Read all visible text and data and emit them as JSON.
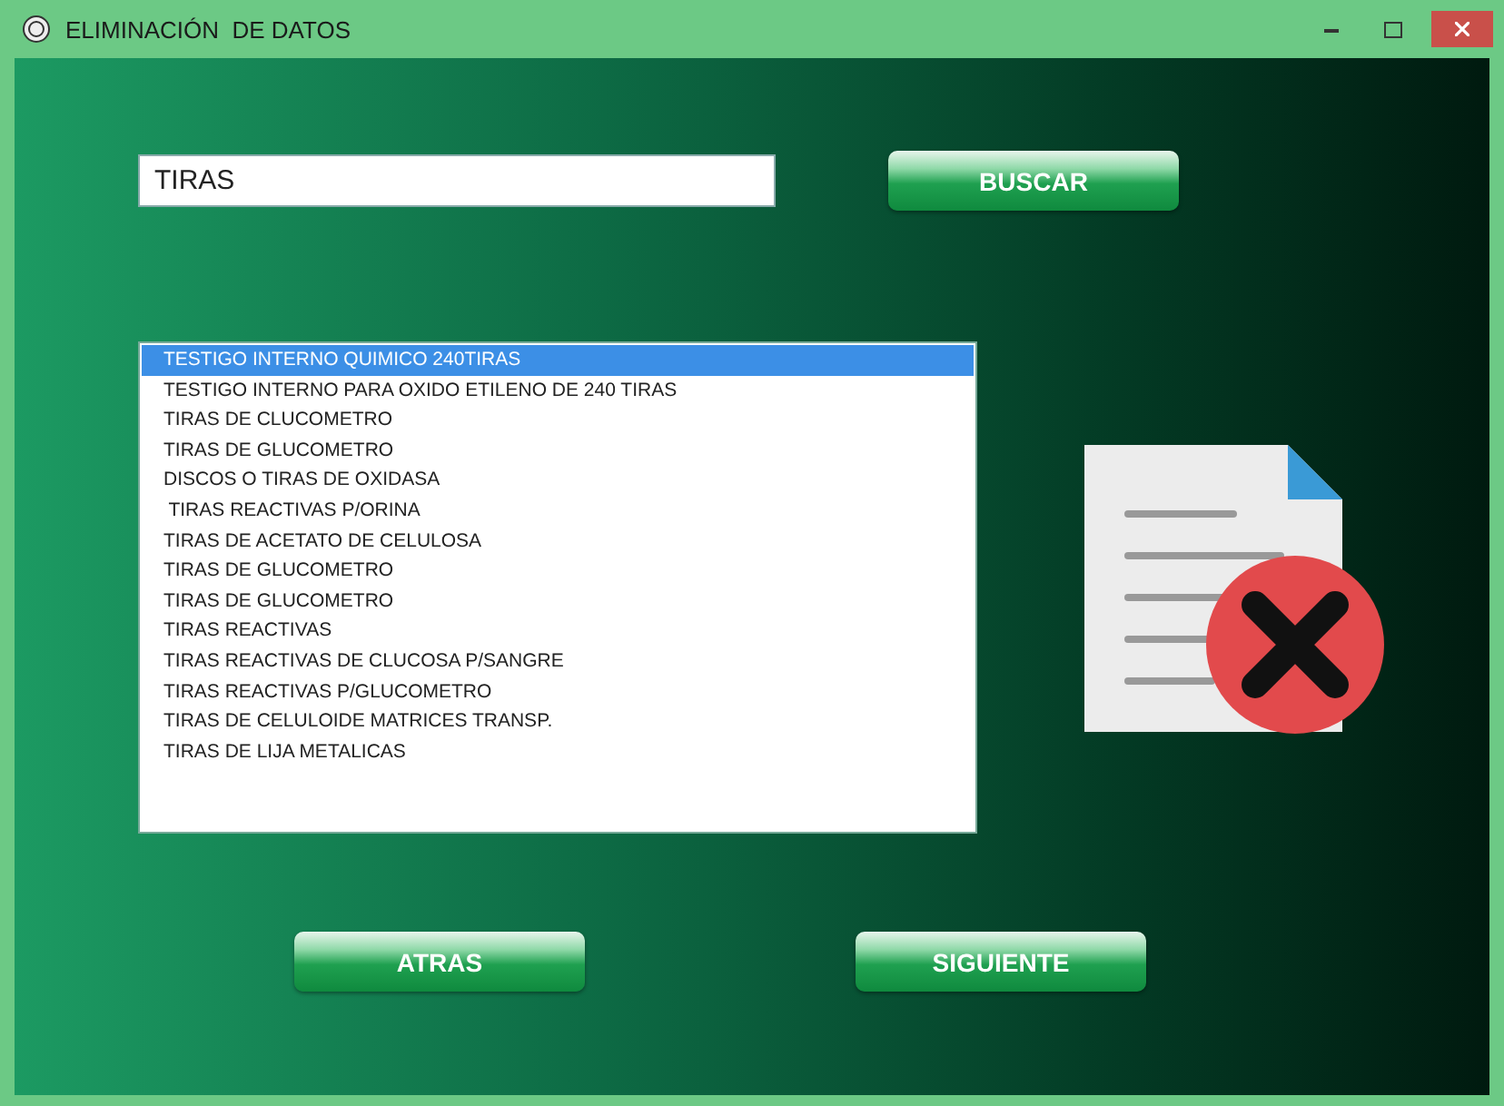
{
  "window": {
    "title": "ELIMINACIÓN  DE DATOS"
  },
  "search": {
    "value": "TIRAS",
    "button": "BUSCAR"
  },
  "results": [
    {
      "label": "TESTIGO INTERNO QUIMICO 240TIRAS",
      "selected": true
    },
    {
      "label": "TESTIGO INTERNO PARA OXIDO ETILENO DE 240 TIRAS",
      "selected": false
    },
    {
      "label": "TIRAS DE CLUCOMETRO",
      "selected": false
    },
    {
      "label": "TIRAS DE GLUCOMETRO",
      "selected": false
    },
    {
      "label": "DISCOS O TIRAS DE OXIDASA",
      "selected": false
    },
    {
      "label": " TIRAS REACTIVAS P/ORINA",
      "selected": false
    },
    {
      "label": "TIRAS DE ACETATO DE CELULOSA",
      "selected": false
    },
    {
      "label": "TIRAS DE GLUCOMETRO",
      "selected": false
    },
    {
      "label": "TIRAS DE GLUCOMETRO",
      "selected": false
    },
    {
      "label": "TIRAS REACTIVAS",
      "selected": false
    },
    {
      "label": "TIRAS REACTIVAS DE CLUCOSA P/SANGRE",
      "selected": false
    },
    {
      "label": "TIRAS REACTIVAS P/GLUCOMETRO",
      "selected": false
    },
    {
      "label": "TIRAS DE CELULOIDE MATRICES TRANSP.",
      "selected": false
    },
    {
      "label": "TIRAS DE LIJA METALICAS",
      "selected": false
    }
  ],
  "buttons": [
    "ATRAS",
    "SIGUIENTE"
  ]
}
